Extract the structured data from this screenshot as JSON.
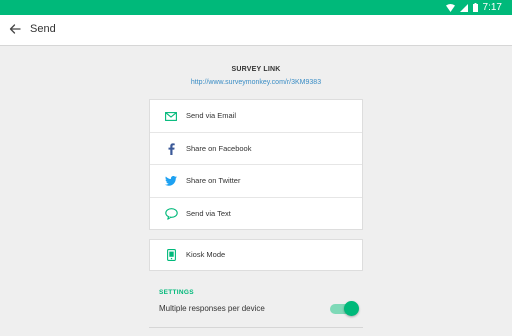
{
  "status_bar": {
    "time": "7:17",
    "icons": [
      "wifi-icon",
      "signal-icon",
      "battery-icon"
    ],
    "color": "#00b97a"
  },
  "app_bar": {
    "title": "Send",
    "back_icon": "arrow-left-icon"
  },
  "survey_link": {
    "label": "SURVEY LINK",
    "url": "http://www.surveymonkey.com/r/3KM9383"
  },
  "share_options": [
    {
      "label": "Send via Email",
      "icon": "email-icon",
      "color": "#00b97a"
    },
    {
      "label": "Share on Facebook",
      "icon": "facebook-icon",
      "color": "#3b5998"
    },
    {
      "label": "Share on Twitter",
      "icon": "twitter-icon",
      "color": "#1da1f2"
    },
    {
      "label": "Send via Text",
      "icon": "chat-bubble-icon",
      "color": "#00b97a"
    }
  ],
  "kiosk": {
    "label": "Kiosk Mode",
    "icon": "tablet-icon",
    "color": "#00b97a"
  },
  "settings": {
    "header": "SETTINGS",
    "multiple_responses_label": "Multiple responses per device",
    "multiple_responses_enabled": true
  },
  "colors": {
    "accent": "#00b97a",
    "link": "#3a8dc5"
  }
}
